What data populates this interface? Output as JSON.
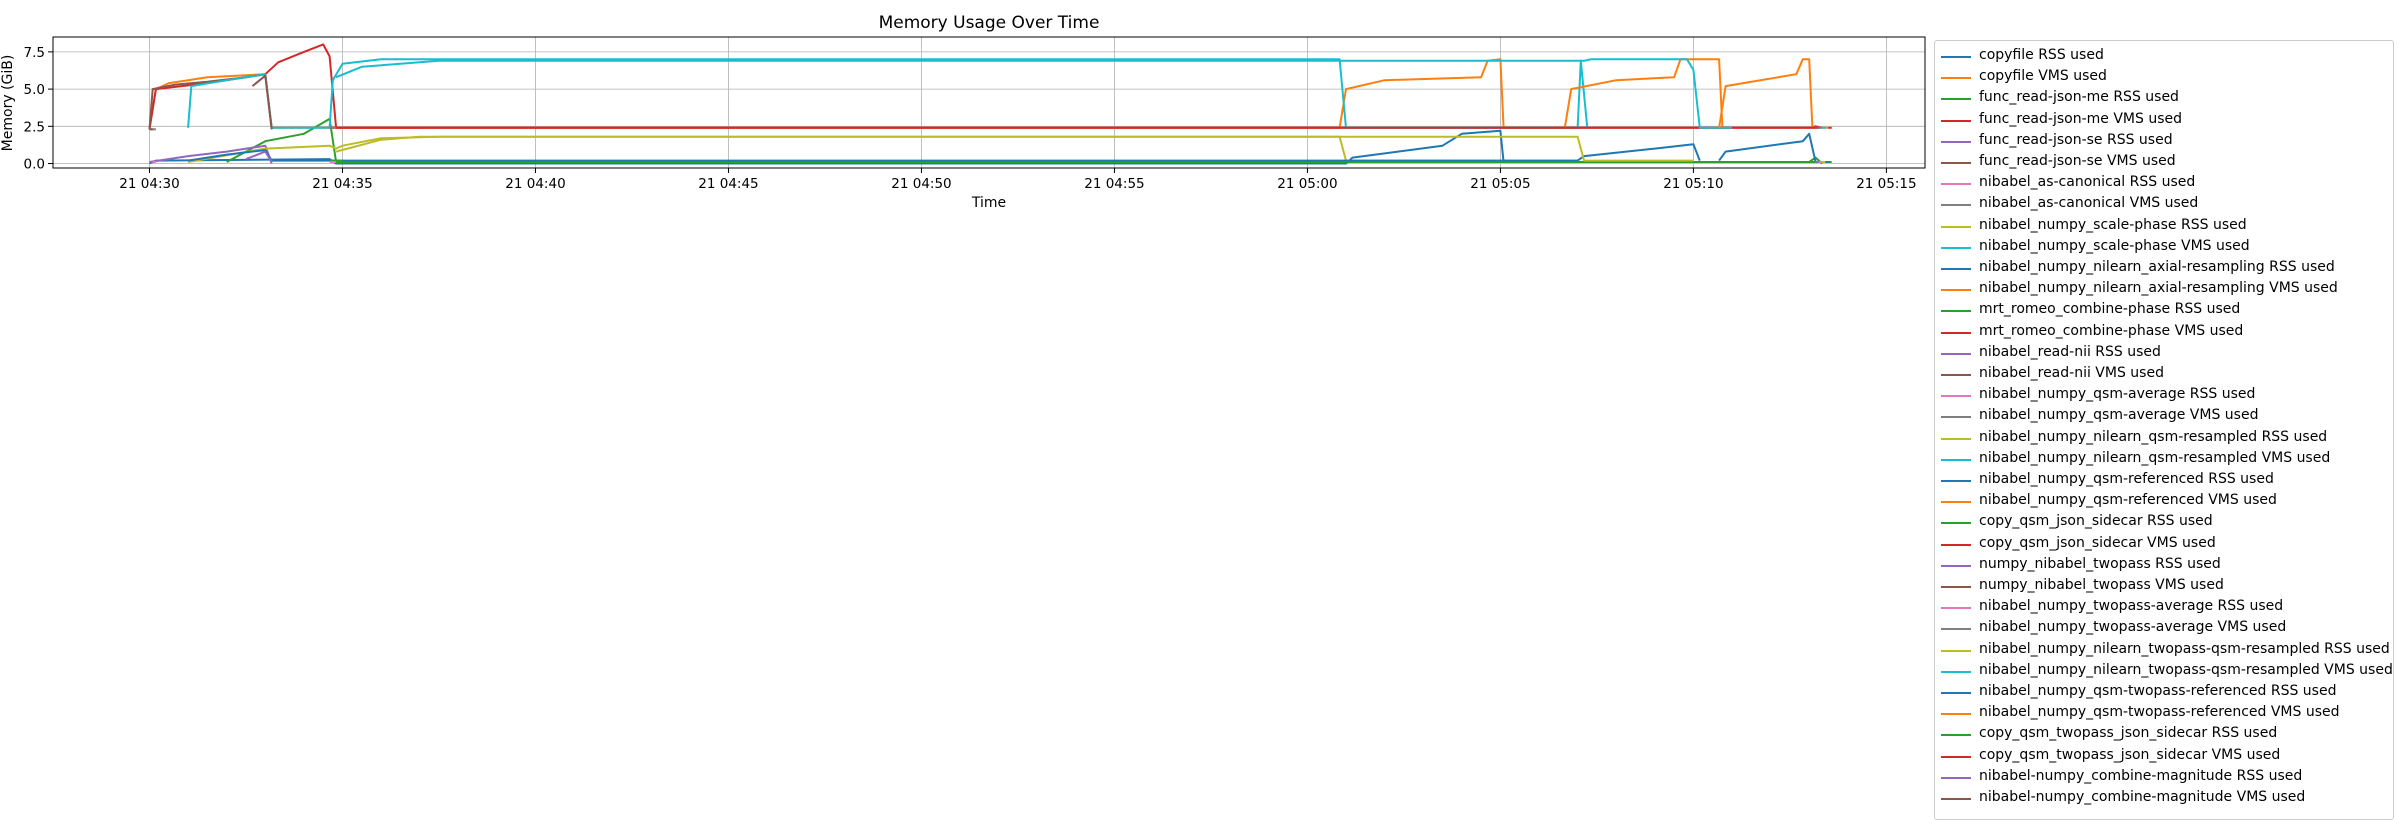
{
  "chart_data": {
    "type": "line",
    "title": "Memory Usage Over Time",
    "xlabel": "Time",
    "ylabel": "Memory (GiB)",
    "x_ticks": [
      "21 04:30",
      "21 04:35",
      "21 04:40",
      "21 04:45",
      "21 04:50",
      "21 04:55",
      "21 05:00",
      "21 05:05",
      "21 05:10",
      "21 05:15"
    ],
    "y_ticks": [
      "0.0",
      "2.5",
      "5.0",
      "7.5"
    ],
    "xlim": [
      "04:27:30",
      "05:16:00"
    ],
    "ylim": [
      -0.3,
      8.5
    ],
    "grid": true,
    "legend_position": "outside right",
    "series": [
      {
        "name": "copyfile RSS used",
        "color": "#1f77b4",
        "points": [
          [
            "04:30:00",
            0.0
          ],
          [
            "04:30:10",
            0.2
          ],
          [
            "04:34:40",
            0.3
          ],
          [
            "04:34:50",
            0.0
          ],
          [
            "05:01:00",
            0.0
          ],
          [
            "05:01:10",
            0.4
          ],
          [
            "05:03:30",
            1.2
          ],
          [
            "05:04:00",
            2.0
          ],
          [
            "05:05:00",
            2.2
          ],
          [
            "05:05:05",
            0.1
          ],
          [
            "05:07:00",
            0.1
          ]
        ]
      },
      {
        "name": "copyfile VMS used",
        "color": "#ff7f0e",
        "points": [
          [
            "04:30:00",
            2.4
          ],
          [
            "04:30:10",
            5.0
          ],
          [
            "04:30:30",
            5.4
          ],
          [
            "04:31:00",
            5.6
          ],
          [
            "04:31:30",
            5.8
          ],
          [
            "04:33:00",
            6.0
          ],
          [
            "04:33:10",
            2.4
          ],
          [
            "05:00:50",
            2.4
          ],
          [
            "05:01:00",
            5.0
          ],
          [
            "05:02:00",
            5.6
          ],
          [
            "05:04:30",
            5.8
          ],
          [
            "05:04:40",
            6.9
          ],
          [
            "05:05:00",
            7.0
          ],
          [
            "05:05:05",
            2.4
          ],
          [
            "05:07:00",
            2.4
          ]
        ]
      },
      {
        "name": "func_read-json-me RSS used",
        "color": "#2ca02c",
        "points": [
          [
            "04:32:00",
            0.1
          ],
          [
            "04:33:00",
            1.5
          ],
          [
            "04:34:00",
            2.0
          ],
          [
            "04:34:40",
            3.0
          ],
          [
            "04:34:50",
            0.1
          ],
          [
            "05:13:00",
            0.1
          ],
          [
            "05:13:10",
            0.4
          ],
          [
            "05:13:20",
            0.0
          ]
        ]
      },
      {
        "name": "func_read-json-me VMS used",
        "color": "#d62728",
        "points": [
          [
            "04:30:00",
            2.3
          ],
          [
            "04:30:10",
            5.0
          ],
          [
            "04:31:30",
            5.4
          ],
          [
            "04:32:30",
            5.8
          ],
          [
            "04:33:00",
            6.0
          ],
          [
            "04:33:20",
            6.8
          ],
          [
            "04:34:00",
            7.5
          ],
          [
            "04:34:30",
            8.0
          ],
          [
            "04:34:40",
            7.2
          ],
          [
            "04:34:50",
            2.4
          ],
          [
            "05:13:00",
            2.4
          ],
          [
            "05:13:10",
            2.5
          ],
          [
            "05:13:20",
            2.4
          ]
        ]
      },
      {
        "name": "func_read-json-se RSS used",
        "color": "#9467bd",
        "points": [
          [
            "04:30:00",
            0.1
          ],
          [
            "04:31:00",
            0.5
          ],
          [
            "04:32:00",
            0.8
          ],
          [
            "04:33:00",
            1.2
          ],
          [
            "04:33:10",
            0.0
          ]
        ]
      },
      {
        "name": "func_read-json-se VMS used",
        "color": "#8c564b",
        "points": [
          [
            "04:30:00",
            2.3
          ],
          [
            "04:30:05",
            5.0
          ],
          [
            "04:30:40",
            5.3
          ],
          [
            "04:31:30",
            5.5
          ],
          [
            "04:32:30",
            5.8
          ],
          [
            "04:33:00",
            6.0
          ],
          [
            "04:33:10",
            2.3
          ]
        ]
      },
      {
        "name": "nibabel_as-canonical RSS used",
        "color": "#e377c2",
        "points": [
          [
            "04:30:00",
            0.1
          ],
          [
            "04:30:10",
            0.1
          ]
        ]
      },
      {
        "name": "nibabel_as-canonical VMS used",
        "color": "#7f7f7f",
        "points": [
          [
            "04:30:00",
            2.3
          ],
          [
            "04:30:10",
            2.3
          ]
        ]
      },
      {
        "name": "nibabel_numpy_scale-phase RSS used",
        "color": "#bcbd22",
        "points": [
          [
            "04:31:00",
            0.1
          ],
          [
            "04:33:00",
            1.0
          ],
          [
            "04:34:40",
            1.2
          ],
          [
            "04:34:50",
            1.0
          ],
          [
            "04:35:00",
            1.2
          ],
          [
            "04:36:00",
            1.7
          ],
          [
            "04:37:30",
            1.8
          ],
          [
            "05:00:50",
            1.8
          ],
          [
            "05:01:00",
            0.2
          ],
          [
            "05:06:00",
            0.2
          ],
          [
            "05:07:00",
            0.2
          ]
        ]
      },
      {
        "name": "nibabel_numpy_scale-phase VMS used",
        "color": "#17becf",
        "points": [
          [
            "04:31:00",
            2.4
          ],
          [
            "04:31:05",
            5.2
          ],
          [
            "04:32:00",
            5.6
          ],
          [
            "04:33:00",
            6.0
          ],
          [
            "04:33:10",
            2.4
          ],
          [
            "04:34:40",
            2.4
          ],
          [
            "04:34:45",
            5.6
          ],
          [
            "04:35:00",
            6.7
          ],
          [
            "04:36:00",
            7.0
          ],
          [
            "05:00:50",
            7.0
          ],
          [
            "05:01:00",
            2.4
          ],
          [
            "05:07:00",
            2.4
          ],
          [
            "05:07:05",
            6.9
          ],
          [
            "05:07:15",
            2.4
          ]
        ]
      },
      {
        "name": "nibabel_numpy_nilearn_axial-resampling RSS used",
        "color": "#1f77b4",
        "points": [
          [
            "04:31:00",
            0.2
          ],
          [
            "04:32:00",
            0.6
          ],
          [
            "04:33:00",
            0.9
          ],
          [
            "04:33:10",
            0.2
          ],
          [
            "05:07:00",
            0.2
          ],
          [
            "05:07:10",
            0.5
          ],
          [
            "05:09:00",
            1.0
          ],
          [
            "05:10:00",
            1.3
          ],
          [
            "05:10:10",
            0.2
          ]
        ]
      },
      {
        "name": "nibabel_numpy_nilearn_axial-resampling VMS used",
        "color": "#ff7f0e",
        "points": [
          [
            "05:06:40",
            2.4
          ],
          [
            "05:06:50",
            5.0
          ],
          [
            "05:08:00",
            5.6
          ],
          [
            "05:09:30",
            5.8
          ],
          [
            "05:09:40",
            7.0
          ],
          [
            "05:10:40",
            7.0
          ],
          [
            "05:10:45",
            2.4
          ],
          [
            "05:11:00",
            2.4
          ]
        ]
      },
      {
        "name": "mrt_romeo_combine-phase RSS used",
        "color": "#2ca02c",
        "points": [
          [
            "04:34:40",
            0.2
          ],
          [
            "04:35:00",
            0.2
          ]
        ]
      },
      {
        "name": "mrt_romeo_combine-phase VMS used",
        "color": "#d62728",
        "points": [
          [
            "04:34:40",
            2.4
          ],
          [
            "05:13:00",
            2.4
          ]
        ]
      },
      {
        "name": "nibabel_read-nii RSS used",
        "color": "#9467bd",
        "points": [
          [
            "04:32:30",
            0.3
          ],
          [
            "04:33:00",
            0.8
          ],
          [
            "04:33:10",
            0.1
          ]
        ]
      },
      {
        "name": "nibabel_read-nii VMS used",
        "color": "#8c564b",
        "points": [
          [
            "04:32:40",
            5.2
          ],
          [
            "04:33:00",
            5.9
          ],
          [
            "04:33:10",
            2.3
          ]
        ]
      },
      {
        "name": "nibabel_numpy_qsm-average RSS used",
        "color": "#e377c2",
        "points": [
          [
            "04:34:40",
            0.1
          ],
          [
            "04:34:50",
            0.1
          ]
        ]
      },
      {
        "name": "nibabel_numpy_qsm-average VMS used",
        "color": "#7f7f7f",
        "points": [
          [
            "04:34:40",
            2.4
          ],
          [
            "04:34:50",
            2.4
          ]
        ]
      },
      {
        "name": "nibabel_numpy_nilearn_qsm-resampled RSS used",
        "color": "#bcbd22",
        "points": [
          [
            "04:34:50",
            0.8
          ],
          [
            "04:36:00",
            1.6
          ],
          [
            "04:37:00",
            1.8
          ],
          [
            "05:06:00",
            1.8
          ],
          [
            "05:07:00",
            1.8
          ],
          [
            "05:07:10",
            0.2
          ],
          [
            "05:10:00",
            0.2
          ]
        ]
      },
      {
        "name": "nibabel_numpy_nilearn_qsm-resampled VMS used",
        "color": "#17becf",
        "points": [
          [
            "04:34:50",
            5.8
          ],
          [
            "04:35:30",
            6.5
          ],
          [
            "04:37:30",
            6.9
          ],
          [
            "05:07:10",
            6.9
          ],
          [
            "05:07:20",
            7.0
          ],
          [
            "05:09:50",
            7.0
          ],
          [
            "05:10:00",
            6.3
          ],
          [
            "05:10:10",
            2.4
          ],
          [
            "05:11:00",
            2.4
          ]
        ]
      },
      {
        "name": "nibabel_numpy_qsm-referenced RSS used",
        "color": "#1f77b4",
        "points": [
          [
            "05:10:40",
            0.2
          ],
          [
            "05:10:50",
            0.8
          ],
          [
            "05:12:50",
            1.5
          ],
          [
            "05:13:00",
            2.0
          ],
          [
            "05:13:10",
            0.1
          ]
        ]
      },
      {
        "name": "nibabel_numpy_qsm-referenced VMS used",
        "color": "#ff7f0e",
        "points": [
          [
            "05:10:40",
            2.4
          ],
          [
            "05:10:50",
            5.2
          ],
          [
            "05:12:40",
            6.0
          ],
          [
            "05:12:50",
            7.0
          ],
          [
            "05:13:00",
            7.0
          ],
          [
            "05:13:05",
            2.4
          ],
          [
            "05:13:20",
            2.4
          ]
        ]
      },
      {
        "name": "copy_qsm_json_sidecar RSS used",
        "color": "#2ca02c",
        "points": [
          [
            "05:13:00",
            0.1
          ],
          [
            "05:13:10",
            0.1
          ]
        ]
      },
      {
        "name": "copy_qsm_json_sidecar VMS used",
        "color": "#d62728",
        "points": [
          [
            "05:13:00",
            2.4
          ],
          [
            "05:13:10",
            2.4
          ]
        ]
      },
      {
        "name": "numpy_nibabel_twopass RSS used",
        "color": "#9467bd",
        "points": [
          [
            "05:13:10",
            0.1
          ],
          [
            "05:13:15",
            0.1
          ]
        ]
      },
      {
        "name": "numpy_nibabel_twopass VMS used",
        "color": "#8c564b",
        "points": [
          [
            "05:13:10",
            2.4
          ],
          [
            "05:13:15",
            2.4
          ]
        ]
      },
      {
        "name": "nibabel_numpy_twopass-average RSS used",
        "color": "#e377c2",
        "points": [
          [
            "05:13:15",
            0.1
          ],
          [
            "05:13:20",
            0.1
          ]
        ]
      },
      {
        "name": "nibabel_numpy_twopass-average VMS used",
        "color": "#7f7f7f",
        "points": [
          [
            "05:13:15",
            2.4
          ],
          [
            "05:13:20",
            2.4
          ]
        ]
      },
      {
        "name": "nibabel_numpy_nilearn_twopass-qsm-resampled RSS used",
        "color": "#bcbd22",
        "points": [
          [
            "05:13:20",
            0.1
          ],
          [
            "05:13:25",
            0.1
          ]
        ]
      },
      {
        "name": "nibabel_numpy_nilearn_twopass-qsm-resampled VMS used",
        "color": "#17becf",
        "points": [
          [
            "05:13:20",
            2.4
          ],
          [
            "05:13:25",
            2.4
          ]
        ]
      },
      {
        "name": "nibabel_numpy_qsm-twopass-referenced RSS used",
        "color": "#1f77b4",
        "points": [
          [
            "05:13:25",
            0.1
          ],
          [
            "05:13:30",
            0.1
          ]
        ]
      },
      {
        "name": "nibabel_numpy_qsm-twopass-referenced VMS used",
        "color": "#ff7f0e",
        "points": [
          [
            "05:13:25",
            2.4
          ],
          [
            "05:13:30",
            2.4
          ]
        ]
      },
      {
        "name": "copy_qsm_twopass_json_sidecar RSS used",
        "color": "#2ca02c",
        "points": [
          [
            "05:13:30",
            0.1
          ],
          [
            "05:13:35",
            0.1
          ]
        ]
      },
      {
        "name": "copy_qsm_twopass_json_sidecar VMS used",
        "color": "#d62728",
        "points": [
          [
            "05:13:30",
            2.4
          ],
          [
            "05:13:35",
            2.4
          ]
        ]
      },
      {
        "name": "nibabel-numpy_combine-magnitude RSS used",
        "color": "#9467bd",
        "points": [
          [
            "04:30:00",
            0.1
          ],
          [
            "04:30:05",
            0.1
          ]
        ]
      },
      {
        "name": "nibabel-numpy_combine-magnitude VMS used",
        "color": "#8c564b",
        "points": [
          [
            "04:30:00",
            2.3
          ],
          [
            "04:30:05",
            2.3
          ]
        ]
      }
    ]
  }
}
